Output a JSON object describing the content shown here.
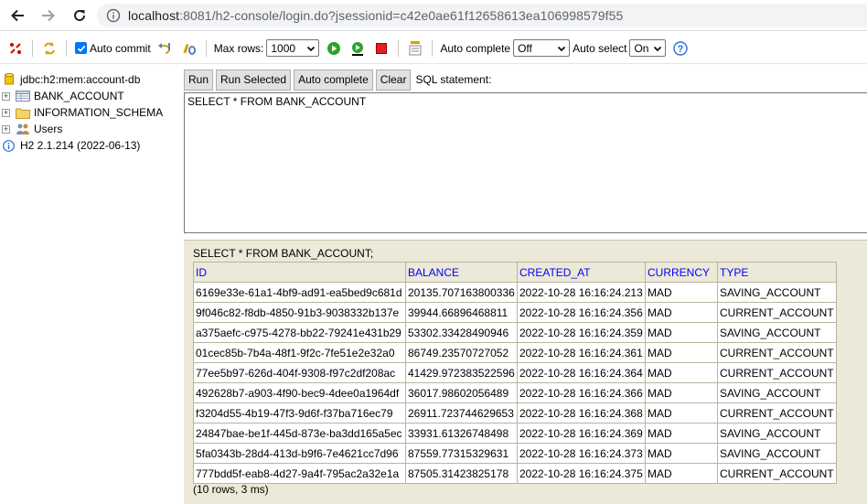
{
  "browser": {
    "url_host": "localhost",
    "url_rest": ":8081/h2-console/login.do?jsessionid=c42e0ae61f12658613ea106998579f55",
    "back_icon": "arrow-left-icon",
    "forward_icon": "arrow-right-icon",
    "reload_icon": "reload-icon",
    "info_icon": "info-icon"
  },
  "toolbar": {
    "auto_commit_label": "Auto commit",
    "auto_commit_checked": true,
    "max_rows_label": "Max rows:",
    "max_rows_value": "1000",
    "auto_complete_label": "Auto complete",
    "auto_complete_value": "Off",
    "auto_select_label": "Auto select",
    "auto_select_value": "On",
    "help_symbol": "?"
  },
  "tree": {
    "connection": "jdbc:h2:mem:account-db",
    "items": [
      {
        "label": "BANK_ACCOUNT",
        "icon": "table-icon"
      },
      {
        "label": "INFORMATION_SCHEMA",
        "icon": "folder-icon"
      },
      {
        "label": "Users",
        "icon": "users-icon"
      }
    ],
    "version": "H2 2.1.214 (2022-06-13)"
  },
  "query": {
    "buttons": {
      "run": "Run",
      "run_selected": "Run Selected",
      "auto_complete": "Auto complete",
      "clear": "Clear"
    },
    "sql_label": "SQL statement:",
    "sql_text": "SELECT * FROM BANK_ACCOUNT"
  },
  "result": {
    "statement": "SELECT * FROM BANK_ACCOUNT;",
    "columns": [
      "ID",
      "BALANCE",
      "CREATED_AT",
      "CURRENCY",
      "TYPE"
    ],
    "rows": [
      [
        "6169e33e-61a1-4bf9-ad91-ea5bed9c681d",
        "20135.707163800336",
        "2022-10-28 16:16:24.213",
        "MAD",
        "SAVING_ACCOUNT"
      ],
      [
        "9f046c82-f8db-4850-91b3-9038332b137e",
        "39944.66896468811",
        "2022-10-28 16:16:24.356",
        "MAD",
        "CURRENT_ACCOUNT"
      ],
      [
        "a375aefc-c975-4278-bb22-79241e431b29",
        "53302.33428490946",
        "2022-10-28 16:16:24.359",
        "MAD",
        "SAVING_ACCOUNT"
      ],
      [
        "01cec85b-7b4a-48f1-9f2c-7fe51e2e32a0",
        "86749.23570727052",
        "2022-10-28 16:16:24.361",
        "MAD",
        "CURRENT_ACCOUNT"
      ],
      [
        "77ee5b97-626d-404f-9308-f97c2df208ac",
        "41429.972383522596",
        "2022-10-28 16:16:24.364",
        "MAD",
        "CURRENT_ACCOUNT"
      ],
      [
        "492628b7-a903-4f90-bec9-4dee0a1964df",
        "36017.98602056489",
        "2022-10-28 16:16:24.366",
        "MAD",
        "SAVING_ACCOUNT"
      ],
      [
        "f3204d55-4b19-47f3-9d6f-f37ba716ec79",
        "26911.723744629653",
        "2022-10-28 16:16:24.368",
        "MAD",
        "CURRENT_ACCOUNT"
      ],
      [
        "24847bae-be1f-445d-873e-ba3dd165a5ec",
        "33931.61326748498",
        "2022-10-28 16:16:24.369",
        "MAD",
        "SAVING_ACCOUNT"
      ],
      [
        "5fa0343b-28d4-413d-b9f6-7e4621cc7d96",
        "87559.77315329631",
        "2022-10-28 16:16:24.373",
        "MAD",
        "SAVING_ACCOUNT"
      ],
      [
        "777bdd5f-eab8-4d27-9a4f-795ac2a32e1a",
        "87505.31423825178",
        "2022-10-28 16:16:24.375",
        "MAD",
        "CURRENT_ACCOUNT"
      ]
    ],
    "footer": "(10 rows, 3 ms)"
  },
  "colors": {
    "result_bg": "#ece9d8",
    "column_header": "#0000ff",
    "checkbox_accent": "#0075ff"
  }
}
